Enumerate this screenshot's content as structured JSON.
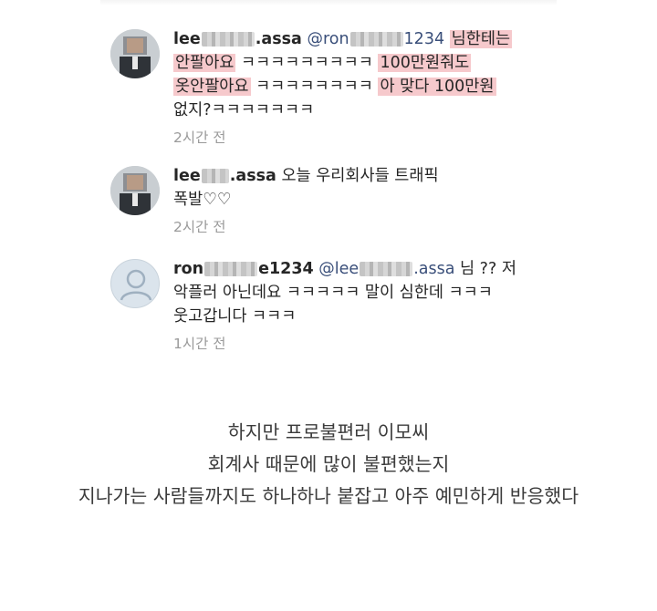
{
  "comments": [
    {
      "username_start": "lee",
      "username_end": ".assa",
      "mention_start": "@ron",
      "mention_end": "1234",
      "segments": [
        "님한테는",
        "안팔아요",
        "ㅋㅋㅋㅋㅋㅋㅋㅋㅋ",
        "100만원줘도",
        "옷안팔아요",
        "ㅋㅋㅋㅋㅋㅋㅋㅋ",
        "아 맞다 100만원",
        "없지?ㅋㅋㅋㅋㅋㅋㅋ"
      ],
      "time": "2시간 전",
      "avatar": "profile-photo"
    },
    {
      "username_start": "lee",
      "username_end": ".assa",
      "text_line1": "오늘 우리회사들 트래픽",
      "text_line2": "폭발♡♡",
      "time": "2시간 전",
      "avatar": "profile-photo"
    },
    {
      "username_start": "ron",
      "username_end": "e1234",
      "mention_start": "@lee",
      "mention_end": ".assa",
      "text_line1": "님 ?? 저",
      "text_line2": "악플러 아닌데요 ㅋㅋㅋㅋㅋ 말이 심한데 ㅋㅋㅋ",
      "text_line3": "웃고갑니다 ㅋㅋㅋ",
      "time": "1시간 전",
      "avatar": "default-profile"
    }
  ],
  "caption": {
    "line1": "하지만 프로불편러 이모씨",
    "line2": "회계사 때문에 많이 불편했는지",
    "line3": "지나가는 사람들까지도 하나하나 붙잡고 아주 예민하게 반응했다"
  },
  "colors": {
    "highlight": "#f6c9cc",
    "mention": "#3a4f7a",
    "timestamp": "#9a9a9a"
  }
}
